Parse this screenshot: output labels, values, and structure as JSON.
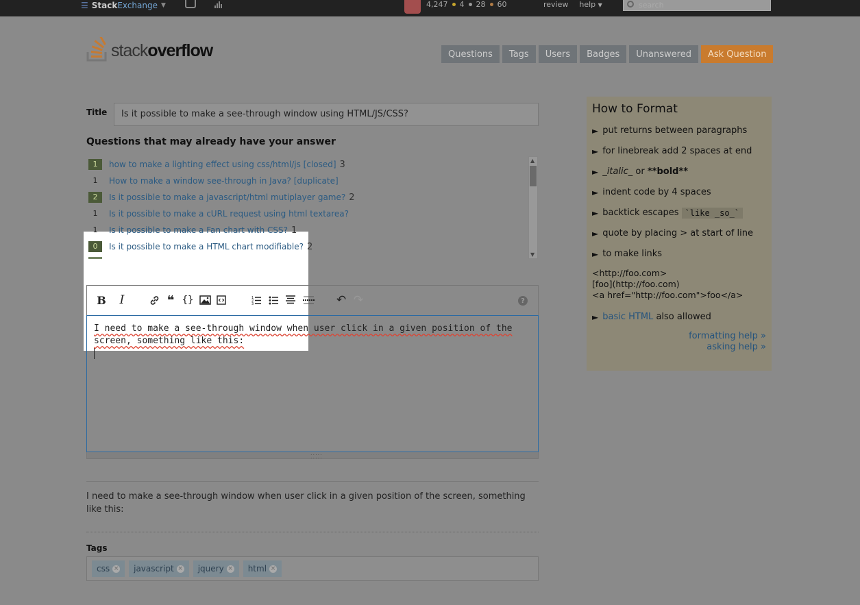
{
  "topbar": {
    "brand_a": "Stack",
    "brand_b": "Exchange",
    "reputation": "4,247",
    "badges_gold": "4",
    "badges_silver": "28",
    "badges_bronze": "60",
    "review": "review",
    "help": "help",
    "search_placeholder": "search",
    "colors": {
      "gold": "#c6a52c",
      "silver": "#999999",
      "bronze": "#b07b45"
    }
  },
  "logo": {
    "word_a": "stack",
    "word_b": "overflow"
  },
  "nav": [
    {
      "label": "Questions"
    },
    {
      "label": "Tags"
    },
    {
      "label": "Users"
    },
    {
      "label": "Badges"
    },
    {
      "label": "Unanswered"
    },
    {
      "label": "Ask Question"
    }
  ],
  "title": {
    "label": "Title",
    "value": "Is it possible to make a see-through window using HTML/JS/CSS?"
  },
  "similar": {
    "heading": "Questions that may already have your answer",
    "items": [
      {
        "votes": "1",
        "accepted": true,
        "text": "how to make a lighting effect using css/html/js [closed]",
        "count": "3"
      },
      {
        "votes": "1",
        "accepted": false,
        "text": "How to make a window see-through in Java? [duplicate]",
        "count": ""
      },
      {
        "votes": "2",
        "accepted": true,
        "text": "Is it possible to make a javascript/html mutiplayer game?",
        "count": "2"
      },
      {
        "votes": "1",
        "accepted": false,
        "text": "Is it possible to make a cURL request using html textarea?",
        "count": ""
      },
      {
        "votes": "1",
        "accepted": false,
        "text": "Is it possible to make a Fan chart with CSS?",
        "count": "1"
      },
      {
        "votes": "0",
        "accepted": true,
        "text": "Is it possible to make a HTML chart modifiable?",
        "count": "2"
      }
    ]
  },
  "toolbar": {
    "bold": "B",
    "italic": "I",
    "link": "🔗",
    "quote": "❝❞",
    "code": "{}",
    "image": "🖼",
    "snippet": "⧉",
    "olist": "≡",
    "ulist": "☰",
    "heading": "☲",
    "hr": "⋯",
    "undo": "↶",
    "redo": "↷",
    "help": "?"
  },
  "editor": {
    "line1": "I need to make a see-through window when user click in a given position of the",
    "line2": "screen, something like this:"
  },
  "preview": {
    "text": "I need to make a see-through window when user click in a given position of the screen, something like this:"
  },
  "tags": {
    "label": "Tags",
    "items": [
      {
        "name": "css"
      },
      {
        "name": "javascript"
      },
      {
        "name": "jquery"
      },
      {
        "name": "html"
      }
    ]
  },
  "howto": {
    "title": "How to Format",
    "tips": [
      "put returns between paragraphs",
      "for linebreak add 2 spaces at end"
    ],
    "italic_a": "_",
    "italic_word": "italic",
    "italic_b": "_",
    "or": "or",
    "bold_text": "**bold**",
    "indent": "indent code by 4 spaces",
    "backtick": "backtick escapes",
    "backtick_code": "`like _so_`",
    "quote": "quote by placing > at start of line",
    "links": "to make links",
    "link_ex1": "<http://foo.com>",
    "link_ex2": "[foo](http://foo.com)",
    "link_ex3": "<a href=\"http://foo.com\">foo</a>",
    "basic_html_link": "basic HTML",
    "basic_html_rest": "also allowed",
    "formatting_help": "formatting help »",
    "asking_help": "asking help »"
  }
}
